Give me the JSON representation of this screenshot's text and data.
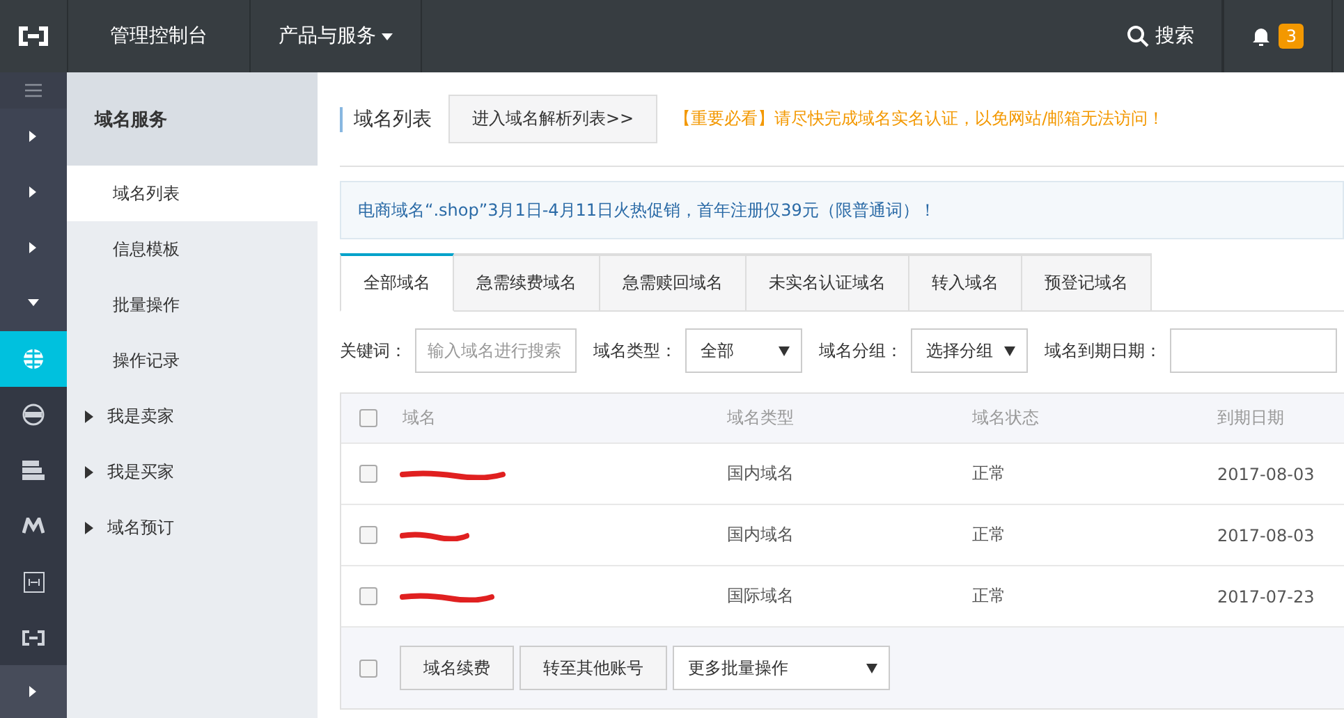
{
  "topbar": {
    "console": "管理控制台",
    "products": "产品与服务",
    "search": "搜索",
    "notifications": "3"
  },
  "rail": [
    {
      "kind": "menu",
      "selected": false
    },
    {
      "kind": "arrow-right",
      "selected": false
    },
    {
      "kind": "arrow-right",
      "selected": false
    },
    {
      "kind": "arrow-right",
      "selected": false
    },
    {
      "kind": "arrow-down",
      "selected": false
    },
    {
      "kind": "globe",
      "selected": true
    },
    {
      "kind": "dns",
      "selected": false
    },
    {
      "kind": "server",
      "selected": false
    },
    {
      "kind": "m",
      "selected": false
    },
    {
      "kind": "bracket",
      "selected": false
    },
    {
      "kind": "logo",
      "selected": false
    },
    {
      "kind": "arrow-right",
      "selected": false
    }
  ],
  "sidebar": {
    "title": "域名服务",
    "items": [
      {
        "label": "域名列表",
        "selected": true,
        "expandable": false
      },
      {
        "label": "信息模板",
        "selected": false,
        "expandable": false
      },
      {
        "label": "批量操作",
        "selected": false,
        "expandable": false
      },
      {
        "label": "操作记录",
        "selected": false,
        "expandable": false
      },
      {
        "label": "我是卖家",
        "selected": false,
        "expandable": true
      },
      {
        "label": "我是买家",
        "selected": false,
        "expandable": true
      },
      {
        "label": "域名预订",
        "selected": false,
        "expandable": true
      }
    ]
  },
  "header": {
    "title": "域名列表",
    "button": "进入域名解析列表>>",
    "warning": "【重要必看】请尽快完成域名实名认证，以免网站/邮箱无法访问！"
  },
  "notice": "电商域名“.shop”3月1日-4月11日火热促销，首年注册仅39元（限普通词）！",
  "tabs": [
    {
      "label": "全部域名",
      "selected": true
    },
    {
      "label": "急需续费域名",
      "selected": false
    },
    {
      "label": "急需赎回域名",
      "selected": false
    },
    {
      "label": "未实名认证域名",
      "selected": false
    },
    {
      "label": "转入域名",
      "selected": false
    },
    {
      "label": "预登记域名",
      "selected": false
    }
  ],
  "filters": {
    "keyword_label": "关键词：",
    "keyword_placeholder": "输入域名进行搜索",
    "type_label": "域名类型：",
    "type_value": "全部",
    "group_label": "域名分组：",
    "group_value": "选择分组",
    "expiry_label": "域名到期日期："
  },
  "table": {
    "header_checked": false,
    "columns": [
      "域名",
      "域名类型",
      "域名状态",
      "到期日期"
    ],
    "rows": [
      {
        "checked": false,
        "domain_redacted": true,
        "type": "国内域名",
        "status": "正常",
        "expiry": "2017-08-03"
      },
      {
        "checked": false,
        "domain_redacted": true,
        "type": "国内域名",
        "status": "正常",
        "expiry": "2017-08-03"
      },
      {
        "checked": false,
        "domain_redacted": true,
        "type": "国际域名",
        "status": "正常",
        "expiry": "2017-07-23"
      }
    ]
  },
  "footer": {
    "checked": false,
    "buttons": [
      "域名续费",
      "转至其他账号"
    ],
    "more": "更多批量操作"
  }
}
